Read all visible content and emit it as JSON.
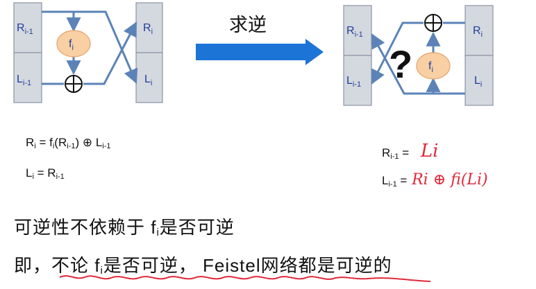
{
  "left_diagram": {
    "box_top_left": "R",
    "box_top_left_sub": "i-1",
    "box_bottom_left": "L",
    "box_bottom_left_sub": "i-1",
    "box_top_right": "R",
    "box_top_right_sub": "i",
    "box_bottom_right": "L",
    "box_bottom_right_sub": "i",
    "func": "f",
    "func_sub": "i"
  },
  "arrow_label": "求逆",
  "right_diagram": {
    "box_top_left": "R",
    "box_top_left_sub": "i-1",
    "box_bottom_left": "L",
    "box_bottom_left_sub": "i-1",
    "box_top_right": "R",
    "box_top_right_sub": "i",
    "box_bottom_right": "L",
    "box_bottom_right_sub": "i",
    "func": "f",
    "func_sub": "i",
    "question": "?"
  },
  "equations_left": {
    "eq1": {
      "lhs": "R",
      "lhs_sub": "i",
      "f": " = f",
      "f_sub": "i",
      "arg_open": "(R",
      "arg_sub": "i-1",
      "arg_close": ") ⊕ L",
      "tail_sub": "i-1"
    },
    "eq2": {
      "lhs": "L",
      "lhs_sub": "i",
      "mid": " = R",
      "mid_sub": "i-1"
    }
  },
  "equations_right": {
    "eq1": {
      "lhs": "R",
      "lhs_sub": "i-1",
      "eq": " =",
      "hand": "Li"
    },
    "eq2": {
      "lhs": "L",
      "lhs_sub": "i-1",
      "eq": " =",
      "hand": "Ri ⊕ fi(Li)"
    }
  },
  "statement1": {
    "pre": "可逆性不依赖于 f",
    "sub": "i",
    "post": "是否可逆"
  },
  "statement2": {
    "pre": "即，",
    "under1": "不论 f",
    "sub": "i",
    "under2": "是否可逆，",
    "post": " Feistel网络都是可逆的"
  },
  "colors": {
    "box_fill": "#d4d8df",
    "box_border": "#8c94a3",
    "box_text": "#1f3f9a",
    "line": "#5b83b7",
    "ellipse_fill": "#f9cfa4",
    "ellipse_border": "#e0a36b",
    "big_arrow": "#1d74d7",
    "handwriting": "#e0283a"
  }
}
